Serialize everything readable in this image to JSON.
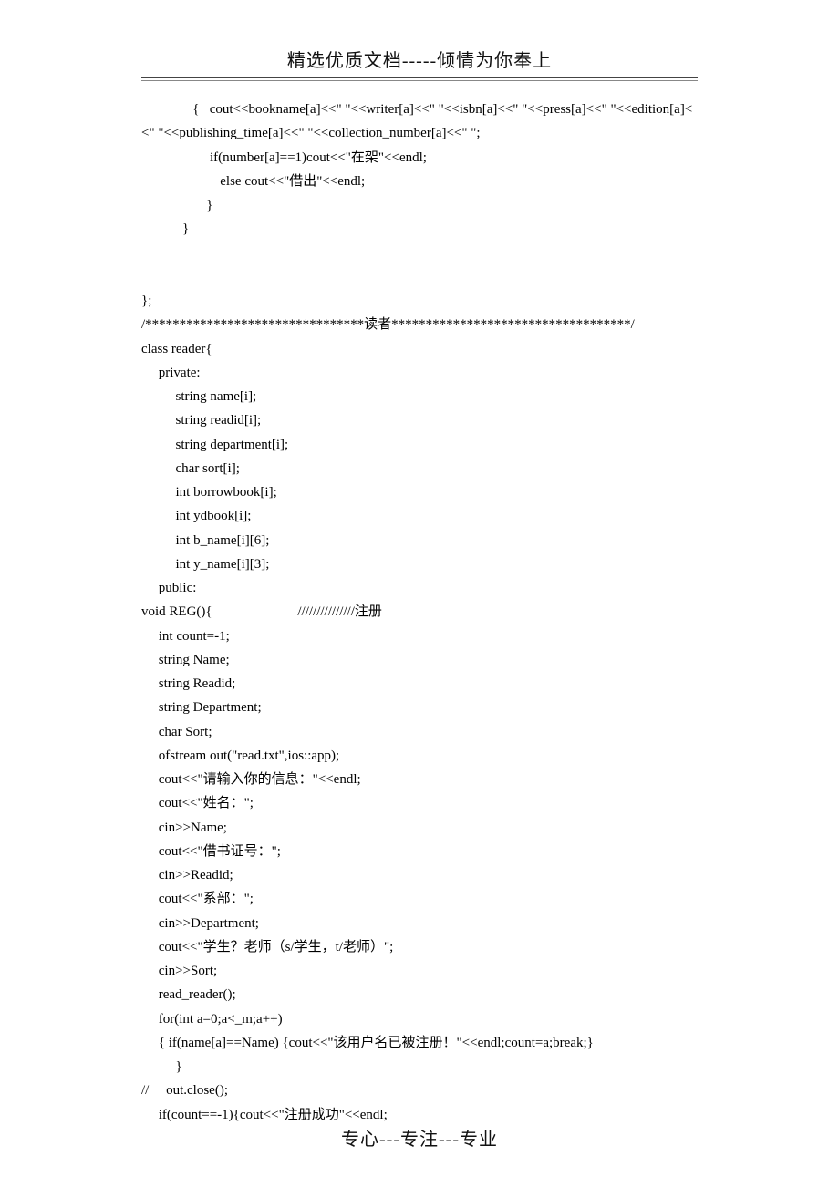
{
  "header": "精选优质文档-----倾情为你奉上",
  "footer": "专心---专注---专业",
  "code_lines": [
    "               {   cout<<bookname[a]<<\" \"<<writer[a]<<\" \"<<isbn[a]<<\" \"<<press[a]<<\" \"<<edition[a]<<\" \"<<publishing_time[a]<<\" \"<<collection_number[a]<<\" \";",
    "                    if(number[a]==1)cout<<\"在架\"<<endl;",
    "                       else cout<<\"借出\"<<endl;",
    "                   }",
    "            }",
    "",
    "",
    "};",
    "/********************************读者***********************************/",
    "class reader{",
    "     private:",
    "          string name[i];",
    "          string readid[i];",
    "          string department[i];",
    "          char sort[i];",
    "          int borrowbook[i];",
    "          int ydbook[i];",
    "          int b_name[i][6];",
    "          int y_name[i][3];",
    "     public:",
    "void REG(){                         ///////////////注册",
    "     int count=-1;",
    "     string Name;",
    "     string Readid;",
    "     string Department;",
    "     char Sort;",
    "     ofstream out(\"read.txt\",ios::app);",
    "     cout<<\"请输入你的信息：\"<<endl;",
    "     cout<<\"姓名：\";",
    "     cin>>Name;",
    "     cout<<\"借书证号：\";",
    "     cin>>Readid;",
    "     cout<<\"系部：\";",
    "     cin>>Department;",
    "     cout<<\"学生？老师（s/学生，t/老师）\";",
    "     cin>>Sort;",
    "     read_reader();",
    "     for(int a=0;a<_m;a++)",
    "     { if(name[a]==Name) {cout<<\"该用户名已被注册！\"<<endl;count=a;break;}",
    "          }",
    "//     out.close();",
    "     if(count==-1){cout<<\"注册成功\"<<endl;"
  ]
}
